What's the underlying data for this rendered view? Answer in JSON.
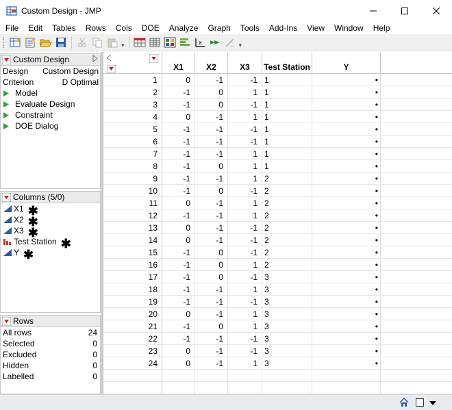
{
  "window": {
    "title": "Custom Design - JMP"
  },
  "menu": [
    "File",
    "Edit",
    "Tables",
    "Rows",
    "Cols",
    "DOE",
    "Analyze",
    "Graph",
    "Tools",
    "Add-Ins",
    "View",
    "Window",
    "Help"
  ],
  "toolbar_icons": [
    "new-data-table-icon",
    "new-script-icon",
    "open-icon",
    "save-icon",
    "cut-icon",
    "copy-icon",
    "paste-icon",
    "data-table-icon",
    "distribution-icon",
    "fit-y-by-x-icon",
    "tabulate-icon",
    "fit-model-icon",
    "graph-builder-icon",
    "annotate-icon"
  ],
  "design_panel": {
    "header": "Custom Design",
    "design_label": "Design",
    "design_value": "Custom Design",
    "criterion_label": "Criterion",
    "criterion_value": "D Optimal",
    "scripts": [
      "Model",
      "Evaluate Design",
      "Constraint",
      "DOE Dialog"
    ]
  },
  "columns_panel": {
    "header": "Columns (5/0)",
    "columns": [
      {
        "name": "X1",
        "type": "continuous"
      },
      {
        "name": "X2",
        "type": "continuous"
      },
      {
        "name": "X3",
        "type": "continuous"
      },
      {
        "name": "Test Station",
        "type": "nominal"
      },
      {
        "name": "Y",
        "type": "continuous"
      }
    ]
  },
  "rows_panel": {
    "header": "Rows",
    "items": [
      {
        "label": "All rows",
        "value": "24"
      },
      {
        "label": "Selected",
        "value": "0"
      },
      {
        "label": "Excluded",
        "value": "0"
      },
      {
        "label": "Hidden",
        "value": "0"
      },
      {
        "label": "Labelled",
        "value": "0"
      }
    ]
  },
  "table": {
    "headers": [
      "X1",
      "X2",
      "X3",
      "Test Station",
      "Y"
    ],
    "rows": [
      [
        "0",
        "-1",
        "-1",
        "1",
        "•"
      ],
      [
        "-1",
        "0",
        "1",
        "1",
        "•"
      ],
      [
        "-1",
        "0",
        "-1",
        "1",
        "•"
      ],
      [
        "0",
        "-1",
        "1",
        "1",
        "•"
      ],
      [
        "-1",
        "-1",
        "-1",
        "1",
        "•"
      ],
      [
        "-1",
        "-1",
        "-1",
        "1",
        "•"
      ],
      [
        "-1",
        "-1",
        "1",
        "1",
        "•"
      ],
      [
        "-1",
        "0",
        "1",
        "1",
        "•"
      ],
      [
        "-1",
        "-1",
        "1",
        "2",
        "•"
      ],
      [
        "-1",
        "0",
        "-1",
        "2",
        "•"
      ],
      [
        "0",
        "-1",
        "1",
        "2",
        "•"
      ],
      [
        "-1",
        "-1",
        "1",
        "2",
        "•"
      ],
      [
        "0",
        "-1",
        "-1",
        "2",
        "•"
      ],
      [
        "0",
        "-1",
        "-1",
        "2",
        "•"
      ],
      [
        "-1",
        "0",
        "-1",
        "2",
        "•"
      ],
      [
        "-1",
        "0",
        "1",
        "2",
        "•"
      ],
      [
        "-1",
        "0",
        "-1",
        "3",
        "•"
      ],
      [
        "-1",
        "-1",
        "1",
        "3",
        "•"
      ],
      [
        "-1",
        "-1",
        "-1",
        "3",
        "•"
      ],
      [
        "0",
        "-1",
        "1",
        "3",
        "•"
      ],
      [
        "-1",
        "0",
        "1",
        "3",
        "•"
      ],
      [
        "-1",
        "-1",
        "-1",
        "3",
        "•"
      ],
      [
        "0",
        "-1",
        "-1",
        "3",
        "•"
      ],
      [
        "0",
        "-1",
        "1",
        "3",
        "•"
      ]
    ]
  },
  "colors": {
    "jmp_red": "#cc1f1f",
    "green_triangle": "#3a9b3a",
    "continuous_blue": "#2e5aa8",
    "nominal_red": "#c8342b"
  }
}
